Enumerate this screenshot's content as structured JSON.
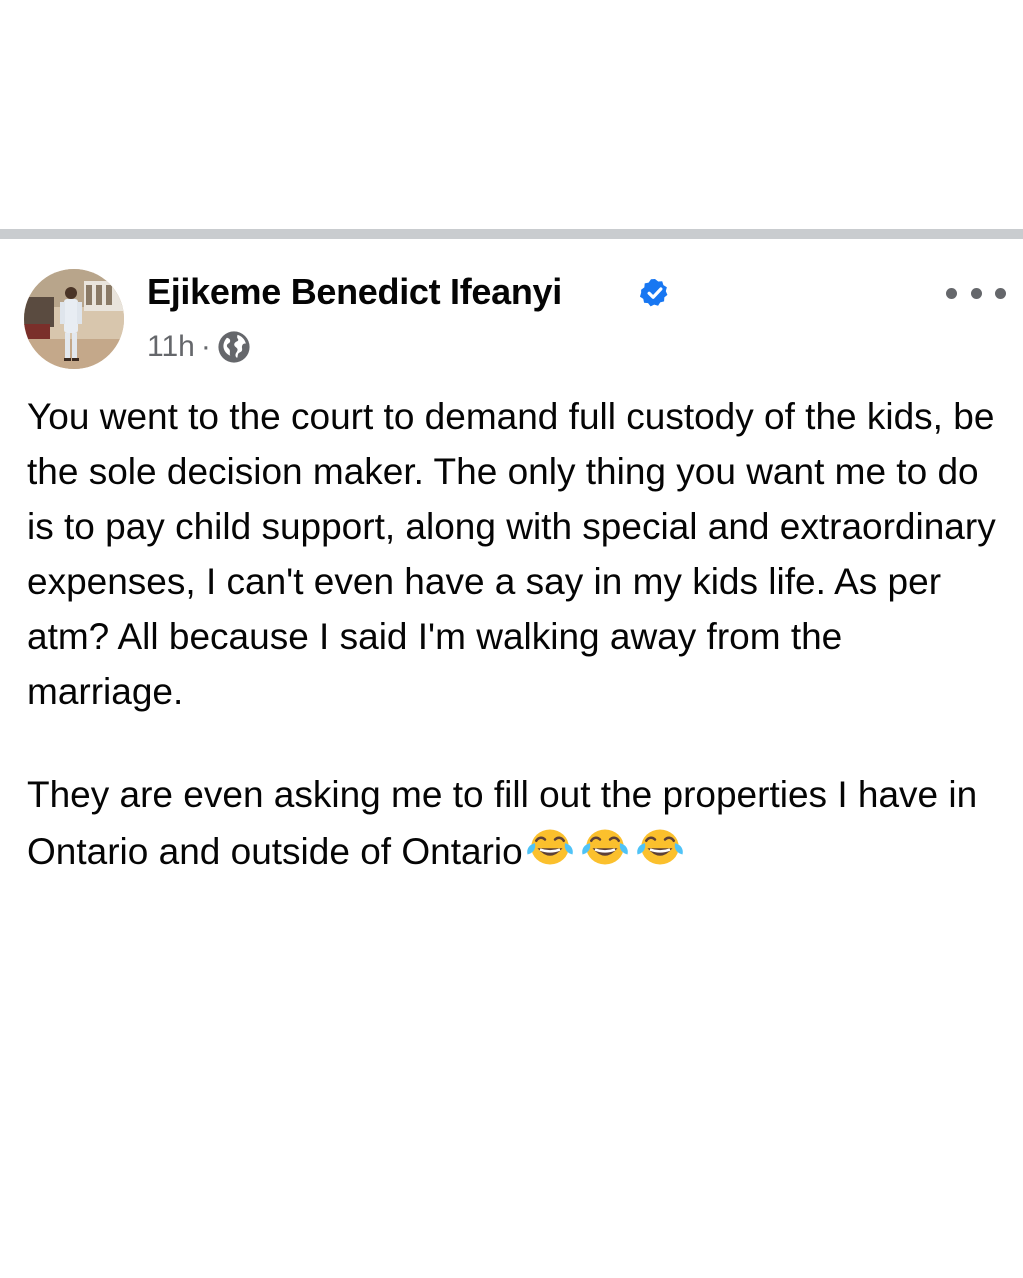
{
  "post": {
    "author": {
      "name": "Ejikeme Benedict Ifeanyi",
      "verified": true,
      "avatar_icon": "profile-photo"
    },
    "meta": {
      "time": "11h",
      "separator": "·",
      "audience_icon": "globe-icon"
    },
    "more_icon": "more-options-icon",
    "body": {
      "paragraph_1": "You went to the court to demand full custody of the kids, be the sole decision maker. The only thing you want me to do is to pay child support, along with special and extraordinary expenses, I can't even have a say in my kids life. As per atm? All because I said I'm walking away from the marriage.",
      "paragraph_2": "They are even asking me to fill out the properties I have in Ontario and outside of Ontario",
      "emojis": [
        "face-with-tears-of-joy",
        "face-with-tears-of-joy",
        "face-with-tears-of-joy"
      ]
    }
  },
  "colors": {
    "divider": "#c9cccf",
    "secondary_text": "#65676b",
    "verified_badge": "#1877f2",
    "emoji_face": "#fbc02d",
    "emoji_tears": "#4fc3f7"
  }
}
